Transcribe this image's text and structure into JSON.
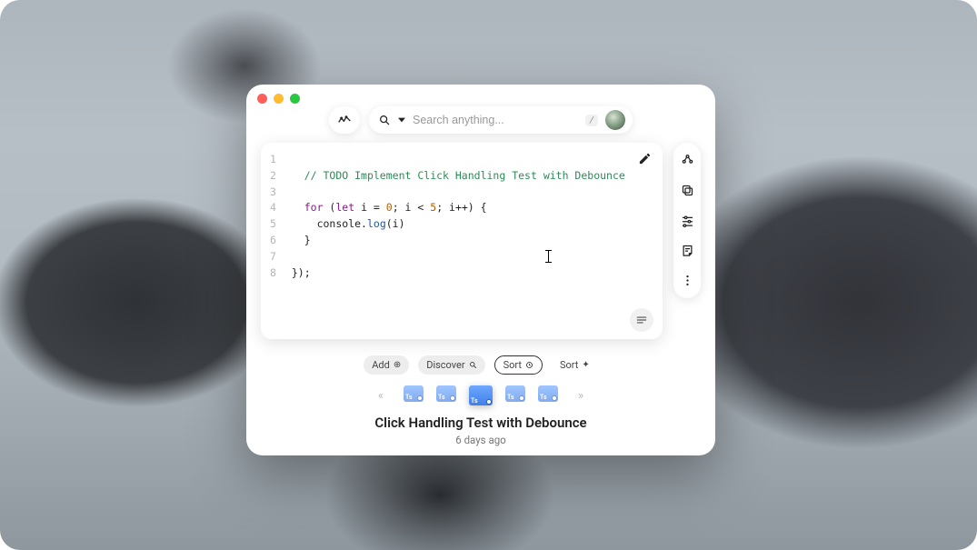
{
  "search": {
    "placeholder": "Search anything...",
    "shortcut": "/"
  },
  "editor": {
    "lines": [
      {
        "n": "1",
        "tokens": []
      },
      {
        "n": "2",
        "tokens": [
          {
            "t": "   ",
            "c": ""
          },
          {
            "t": "// TODO Implement Click Handling Test with Debounce",
            "c": "tok-comment"
          }
        ]
      },
      {
        "n": "3",
        "tokens": []
      },
      {
        "n": "4",
        "tokens": [
          {
            "t": "   ",
            "c": ""
          },
          {
            "t": "for",
            "c": "tok-keyword"
          },
          {
            "t": " (",
            "c": ""
          },
          {
            "t": "let",
            "c": "tok-keyword"
          },
          {
            "t": " i = ",
            "c": "tok-ident"
          },
          {
            "t": "0",
            "c": "tok-number"
          },
          {
            "t": "; i < ",
            "c": "tok-ident"
          },
          {
            "t": "5",
            "c": "tok-number"
          },
          {
            "t": "; i++) {",
            "c": "tok-ident"
          }
        ]
      },
      {
        "n": "5",
        "tokens": [
          {
            "t": "     ",
            "c": ""
          },
          {
            "t": "console",
            "c": "tok-ident"
          },
          {
            "t": ".",
            "c": ""
          },
          {
            "t": "log",
            "c": "tok-prop"
          },
          {
            "t": "(i)",
            "c": "tok-ident"
          }
        ]
      },
      {
        "n": "6",
        "tokens": [
          {
            "t": "   }",
            "c": "tok-ident"
          }
        ]
      },
      {
        "n": "7",
        "tokens": []
      },
      {
        "n": "8",
        "tokens": [
          {
            "t": " });",
            "c": "tok-ident"
          }
        ]
      }
    ]
  },
  "actions": {
    "add": {
      "label": "Add"
    },
    "discover": {
      "label": "Discover"
    },
    "sort1": {
      "label": "Sort"
    },
    "sort2": {
      "label": "Sort"
    }
  },
  "item": {
    "title": "Click Handling Test with Debounce",
    "time": "6 days ago"
  },
  "icons": {
    "sparkline": "sparkline",
    "search": "search",
    "dropdown": "dropdown",
    "pencil": "pencil",
    "wrap": "wrap",
    "share": "share",
    "copy": "copy",
    "sliders": "sliders",
    "note": "note",
    "more": "more"
  }
}
